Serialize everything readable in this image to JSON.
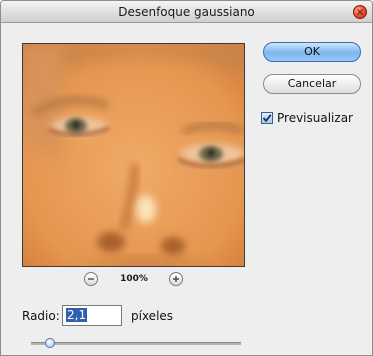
{
  "window": {
    "title": "Desenfoque gaussiano"
  },
  "buttons": {
    "ok_label": "OK",
    "cancel_label": "Cancelar"
  },
  "preview": {
    "checkbox_label": "Previsualizar",
    "checked": true
  },
  "zoom": {
    "level": "100%"
  },
  "radius": {
    "label": "Radio:",
    "value": "2,1",
    "unit": "píxeles",
    "slider_level": 0.08
  },
  "colors": {
    "ok_button": "#7cb5ef",
    "selection": "#2f5fb3",
    "close_button": "#e8553a"
  }
}
